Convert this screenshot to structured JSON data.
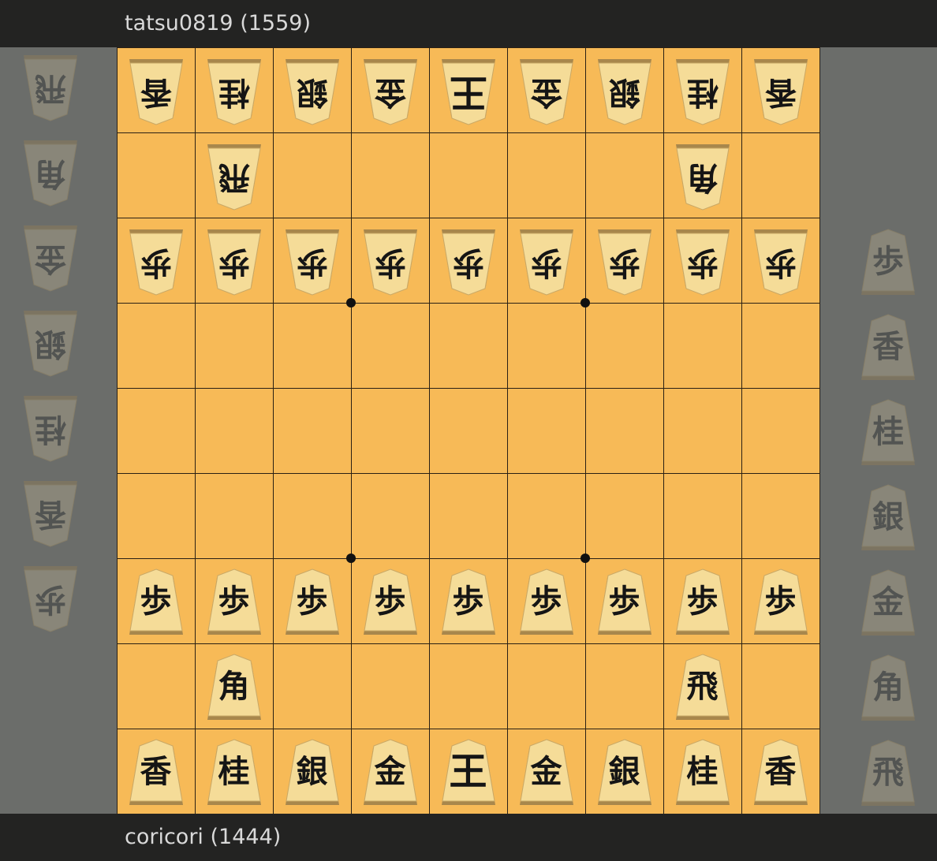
{
  "players": {
    "top": {
      "name": "tatsu0819 (1559)"
    },
    "bottom": {
      "name": "coricori (1444)"
    }
  },
  "colors": {
    "board": "#f7ba57",
    "piece_face": "#f5dc98",
    "background": "#6b6d6a",
    "bar": "#232322"
  },
  "board": {
    "files": 9,
    "ranks": 9,
    "pieces": [
      {
        "rank": 1,
        "file": 9,
        "kanji": "香",
        "owner": "gote"
      },
      {
        "rank": 1,
        "file": 8,
        "kanji": "桂",
        "owner": "gote"
      },
      {
        "rank": 1,
        "file": 7,
        "kanji": "銀",
        "owner": "gote"
      },
      {
        "rank": 1,
        "file": 6,
        "kanji": "金",
        "owner": "gote"
      },
      {
        "rank": 1,
        "file": 5,
        "kanji": "王",
        "owner": "gote"
      },
      {
        "rank": 1,
        "file": 4,
        "kanji": "金",
        "owner": "gote"
      },
      {
        "rank": 1,
        "file": 3,
        "kanji": "銀",
        "owner": "gote"
      },
      {
        "rank": 1,
        "file": 2,
        "kanji": "桂",
        "owner": "gote"
      },
      {
        "rank": 1,
        "file": 1,
        "kanji": "香",
        "owner": "gote"
      },
      {
        "rank": 2,
        "file": 8,
        "kanji": "飛",
        "owner": "gote"
      },
      {
        "rank": 2,
        "file": 2,
        "kanji": "角",
        "owner": "gote"
      },
      {
        "rank": 3,
        "file": 9,
        "kanji": "歩",
        "owner": "gote"
      },
      {
        "rank": 3,
        "file": 8,
        "kanji": "歩",
        "owner": "gote"
      },
      {
        "rank": 3,
        "file": 7,
        "kanji": "歩",
        "owner": "gote"
      },
      {
        "rank": 3,
        "file": 6,
        "kanji": "歩",
        "owner": "gote"
      },
      {
        "rank": 3,
        "file": 5,
        "kanji": "歩",
        "owner": "gote"
      },
      {
        "rank": 3,
        "file": 4,
        "kanji": "歩",
        "owner": "gote"
      },
      {
        "rank": 3,
        "file": 3,
        "kanji": "歩",
        "owner": "gote"
      },
      {
        "rank": 3,
        "file": 2,
        "kanji": "歩",
        "owner": "gote"
      },
      {
        "rank": 3,
        "file": 1,
        "kanji": "歩",
        "owner": "gote"
      },
      {
        "rank": 7,
        "file": 9,
        "kanji": "歩",
        "owner": "sente"
      },
      {
        "rank": 7,
        "file": 8,
        "kanji": "歩",
        "owner": "sente"
      },
      {
        "rank": 7,
        "file": 7,
        "kanji": "歩",
        "owner": "sente"
      },
      {
        "rank": 7,
        "file": 6,
        "kanji": "歩",
        "owner": "sente"
      },
      {
        "rank": 7,
        "file": 5,
        "kanji": "歩",
        "owner": "sente"
      },
      {
        "rank": 7,
        "file": 4,
        "kanji": "歩",
        "owner": "sente"
      },
      {
        "rank": 7,
        "file": 3,
        "kanji": "歩",
        "owner": "sente"
      },
      {
        "rank": 7,
        "file": 2,
        "kanji": "歩",
        "owner": "sente"
      },
      {
        "rank": 7,
        "file": 1,
        "kanji": "歩",
        "owner": "sente"
      },
      {
        "rank": 8,
        "file": 8,
        "kanji": "角",
        "owner": "sente"
      },
      {
        "rank": 8,
        "file": 2,
        "kanji": "飛",
        "owner": "sente"
      },
      {
        "rank": 9,
        "file": 9,
        "kanji": "香",
        "owner": "sente"
      },
      {
        "rank": 9,
        "file": 8,
        "kanji": "桂",
        "owner": "sente"
      },
      {
        "rank": 9,
        "file": 7,
        "kanji": "銀",
        "owner": "sente"
      },
      {
        "rank": 9,
        "file": 6,
        "kanji": "金",
        "owner": "sente"
      },
      {
        "rank": 9,
        "file": 5,
        "kanji": "王",
        "owner": "sente"
      },
      {
        "rank": 9,
        "file": 4,
        "kanji": "金",
        "owner": "sente"
      },
      {
        "rank": 9,
        "file": 3,
        "kanji": "銀",
        "owner": "sente"
      },
      {
        "rank": 9,
        "file": 2,
        "kanji": "桂",
        "owner": "sente"
      },
      {
        "rank": 9,
        "file": 1,
        "kanji": "香",
        "owner": "sente"
      }
    ]
  },
  "hands": {
    "gote": [
      {
        "kanji": "飛"
      },
      {
        "kanji": "角"
      },
      {
        "kanji": "金"
      },
      {
        "kanji": "銀"
      },
      {
        "kanji": "桂"
      },
      {
        "kanji": "香"
      },
      {
        "kanji": "歩"
      }
    ],
    "sente": [
      {
        "kanji": "歩"
      },
      {
        "kanji": "香"
      },
      {
        "kanji": "桂"
      },
      {
        "kanji": "銀"
      },
      {
        "kanji": "金"
      },
      {
        "kanji": "角"
      },
      {
        "kanji": "飛"
      }
    ]
  }
}
